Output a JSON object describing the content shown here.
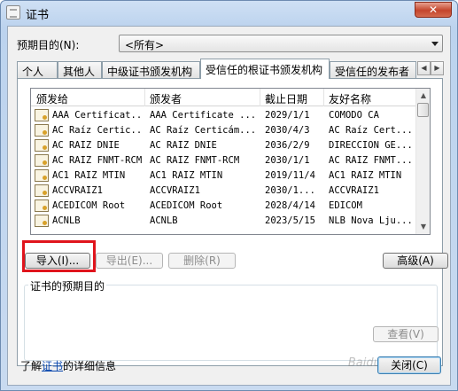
{
  "window": {
    "title": "证书",
    "close_glyph": "✕"
  },
  "purpose": {
    "label": "预期目的(N):",
    "selected": "<所有>"
  },
  "tabs": [
    "个人",
    "其他人",
    "中级证书颁发机构",
    "受信任的根证书颁发机构",
    "受信任的发布者"
  ],
  "active_tab_index": 3,
  "columns": [
    "颁发给",
    "颁发者",
    "截止日期",
    "友好名称"
  ],
  "rows": [
    [
      "AAA Certificat...",
      "AAA Certificate ...",
      "2029/1/1",
      "COMODO CA"
    ],
    [
      "AC Raíz Certic...",
      "AC Raíz Certicám...",
      "2030/4/3",
      "AC Raíz Cert..."
    ],
    [
      "AC RAIZ DNIE",
      "AC RAIZ DNIE",
      "2036/2/9",
      "DIRECCION GE..."
    ],
    [
      "AC RAIZ FNMT-RCM",
      "AC RAIZ FNMT-RCM",
      "2030/1/1",
      "AC RAIZ FNMT..."
    ],
    [
      "AC1 RAIZ MTIN",
      "AC1 RAIZ MTIN",
      "2019/11/4",
      "AC1 RAIZ MTIN"
    ],
    [
      "ACCVRAIZ1",
      "ACCVRAIZ1",
      "2030/1...",
      "ACCVRAIZ1"
    ],
    [
      "ACEDICOM Root",
      "ACEDICOM Root",
      "2028/4/14",
      "EDICOM"
    ],
    [
      "ACNLB",
      "ACNLB",
      "2023/5/15",
      "NLB Nova Lju..."
    ]
  ],
  "buttons": {
    "import": "导入(I)...",
    "export": "导出(E)...",
    "remove": "删除(R)",
    "advanced": "高级(A)",
    "view": "查看(V)",
    "close": "关闭(C)"
  },
  "group_title": "证书的预期目的",
  "footer": {
    "prefix": "了解",
    "link": "证书",
    "suffix": "的详细信息"
  },
  "watermark": "Baidu 经验",
  "colors": {
    "highlight": "#e0141c",
    "link": "#0645ad",
    "title_bar": "#bcd3ee"
  }
}
